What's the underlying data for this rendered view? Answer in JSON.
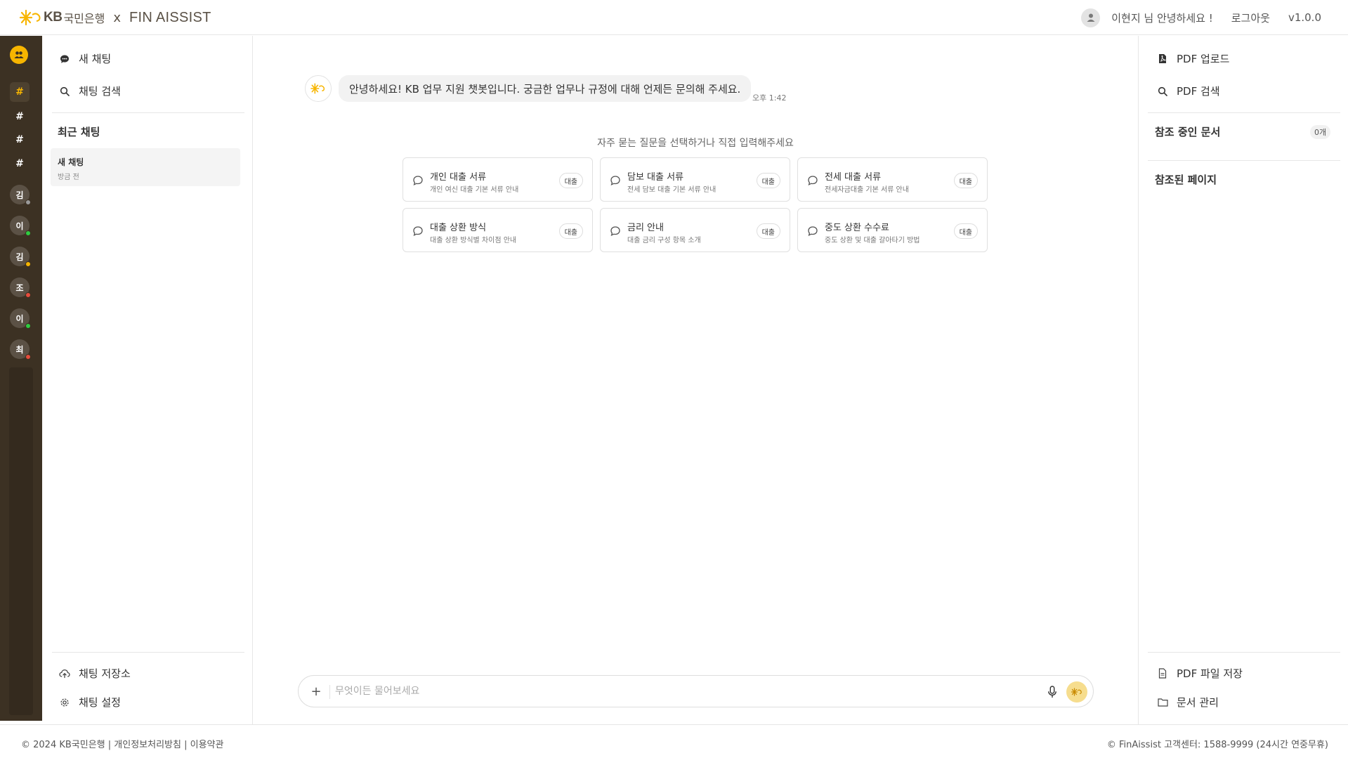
{
  "header": {
    "logo_kb": "KB",
    "logo_bank": "국민은행",
    "logo_x": "x",
    "logo_fin": "FIN AISSIST",
    "greeting": "이현지 님 안녕하세요 !",
    "logout": "로그아웃",
    "version": "v1.0.0"
  },
  "rail": {
    "hash": "#",
    "avatars": [
      {
        "initial": "김",
        "status": "#9a9a9a"
      },
      {
        "initial": "이",
        "status": "#2ecc40"
      },
      {
        "initial": "김",
        "status": "#f7b500"
      },
      {
        "initial": "조",
        "status": "#e74c3c"
      },
      {
        "initial": "이",
        "status": "#2ecc40"
      },
      {
        "initial": "최",
        "status": "#e74c3c"
      }
    ]
  },
  "left": {
    "new_chat": "새 채팅",
    "search_chat": "채팅 검색",
    "recent_title": "최근 채팅",
    "recent": [
      {
        "title": "새 채팅",
        "time": "방금 전"
      }
    ],
    "storage": "채팅 저장소",
    "settings": "채팅 설정"
  },
  "main": {
    "bot_message": "안녕하세요! KB 업무 지원 챗봇입니다. 궁금한 업무나 규정에 대해 언제든 문의해 주세요.",
    "time": "오후 1:42",
    "faq_prompt": "자주 묻는 질문을 선택하거나 직접 입력해주세요",
    "faq": [
      {
        "title": "개인 대출 서류",
        "sub": "개인 여신 대출 기본 서류 안내",
        "tag": "대출"
      },
      {
        "title": "담보 대출 서류",
        "sub": "전세 담보 대출 기본 서류 안내",
        "tag": "대출"
      },
      {
        "title": "전세 대출 서류",
        "sub": "전세자금대출 기본 서류 안내",
        "tag": "대출"
      },
      {
        "title": "대출 상환 방식",
        "sub": "대출 상환 방식별 차이점 안내",
        "tag": "대출"
      },
      {
        "title": "금리 안내",
        "sub": "대출 금리 구성 항목 소개",
        "tag": "대출"
      },
      {
        "title": "중도 상환 수수료",
        "sub": "중도 상환 및 대출 갈아타기 방법",
        "tag": "대출"
      }
    ],
    "input_placeholder": "무엇이든 물어보세요",
    "plus": "+"
  },
  "right": {
    "pdf_upload": "PDF 업로드",
    "pdf_search": "PDF 검색",
    "ref_docs": "참조 중인 문서",
    "ref_count": "0개",
    "ref_pages": "참조된 페이지",
    "pdf_save": "PDF 파일 저장",
    "doc_manage": "문서 관리"
  },
  "footer": {
    "copyright": "© 2024 KB국민은행",
    "sep": " | ",
    "privacy": "개인정보처리방침",
    "terms": "이용약관",
    "right": "© FinAissist 고객센터: 1588-9999 (24시간 연중무휴)"
  },
  "colors": {
    "accent": "#f7b500",
    "rail": "#3c3123",
    "send": "#f6dd8e"
  }
}
